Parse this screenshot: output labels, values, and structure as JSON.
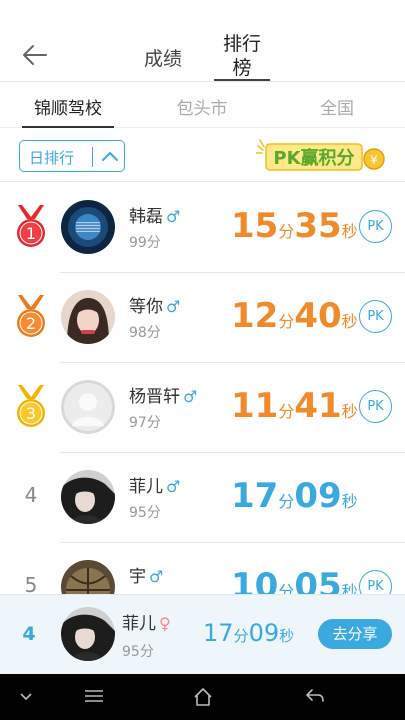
{
  "header": {
    "tabs": [
      {
        "label": "成绩"
      },
      {
        "label": "排行榜"
      }
    ],
    "active_tab": 1
  },
  "subtabs": [
    {
      "label": "锦顺驾校"
    },
    {
      "label": "包头市"
    },
    {
      "label": "全国"
    }
  ],
  "filter": {
    "period_label": "日排行",
    "logo_text": "PK赢积分"
  },
  "ranking": [
    {
      "rank": "1",
      "name": "韩磊",
      "gender": "♂",
      "score": "99分",
      "min": "15",
      "min_unit": "分",
      "sec": "35",
      "sec_unit": "秒",
      "time_color": "orange",
      "pk": "PK"
    },
    {
      "rank": "2",
      "name": "等你",
      "gender": "♂",
      "score": "98分",
      "min": "12",
      "min_unit": "分",
      "sec": "40",
      "sec_unit": "秒",
      "time_color": "orange",
      "pk": "PK"
    },
    {
      "rank": "3",
      "name": "杨晋轩",
      "gender": "♂",
      "score": "97分",
      "min": "11",
      "min_unit": "分",
      "sec": "41",
      "sec_unit": "秒",
      "time_color": "orange",
      "pk": "PK"
    },
    {
      "rank": "4",
      "name": "菲儿",
      "gender": "♂",
      "score": "95分",
      "min": "17",
      "min_unit": "分",
      "sec": "09",
      "sec_unit": "秒",
      "time_color": "blue",
      "pk": ""
    },
    {
      "rank": "5",
      "name": "宇",
      "gender": "♂",
      "score": "",
      "min": "10",
      "min_unit": "分",
      "sec": "05",
      "sec_unit": "秒",
      "time_color": "blue",
      "pk": "PK"
    }
  ],
  "self": {
    "rank": "4",
    "name": "菲儿",
    "gender": "♀",
    "score": "95分",
    "min": "17",
    "min_unit": "分",
    "sec": "09",
    "sec_unit": "秒",
    "share_label": "去分享"
  },
  "colors": {
    "accent": "#39a9e0",
    "orange": "#f08a2a",
    "gold_medal": "#f5b400",
    "red_medal": "#e8262b"
  }
}
